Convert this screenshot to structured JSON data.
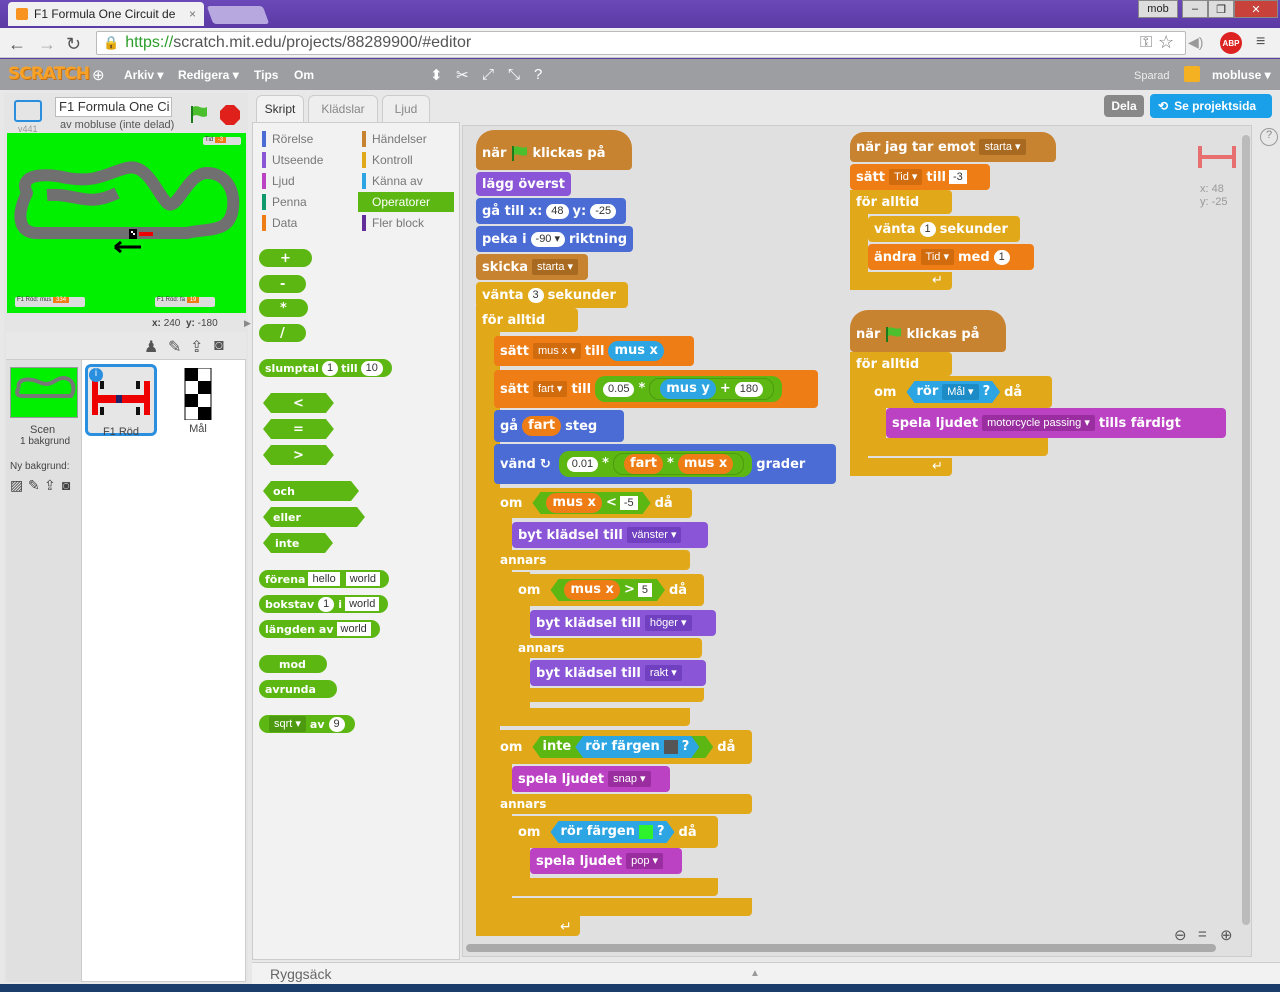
{
  "browser": {
    "tab_title": "F1 Formula One Circuit de",
    "url_https": "https://",
    "url_rest": "scratch.mit.edu/projects/88289900/#editor",
    "window_user": "mob",
    "abp": "ABP"
  },
  "menu": {
    "logo": "SCRATCH",
    "items": [
      "Arkiv",
      "Redigera",
      "Tips",
      "Om"
    ],
    "saved": "Sparad",
    "user": "mobluse",
    "share": "Dela",
    "see_project": "Se projektsida"
  },
  "stage": {
    "project_title": "F1 Formula One Ci",
    "version": "v441",
    "byline": "av mobluse (inte delad)",
    "x_label": "x:",
    "x_val": "240",
    "y_label": "y:",
    "y_val": "-180",
    "mon_tid": "Tid",
    "mon_tid_val": "-3",
    "mon1_label": "F1 Röd: mus",
    "mon1_val": "334",
    "mon2_label": "F1 Röd: fa",
    "mon2_val": "19"
  },
  "sprites": {
    "scene_label": "Scen",
    "scene_sub": "1 bakgrund",
    "new_bg": "Ny bakgrund:",
    "items": [
      {
        "name": "F1 Röd"
      },
      {
        "name": "Mål"
      }
    ]
  },
  "tabs": [
    "Skript",
    "Klädslar",
    "Ljud"
  ],
  "categories_left": [
    "Rörelse",
    "Utseende",
    "Ljud",
    "Penna",
    "Data"
  ],
  "categories_right": [
    "Händelser",
    "Kontroll",
    "Känna av",
    "Operatorer",
    "Fler block"
  ],
  "category_colors": {
    "Rörelse": "#4a6cd4",
    "Utseende": "#8a55d7",
    "Ljud": "#bb42c3",
    "Penna": "#0e9a6c",
    "Data": "#ee7d16",
    "Händelser": "#c88330",
    "Kontroll": "#e1a91a",
    "Känna av": "#2ca5e2",
    "Operatorer": "#5cb712",
    "Fler block": "#632d99"
  },
  "palette": {
    "plus": "+",
    "minus": "-",
    "times": "*",
    "div": "/",
    "random": "slumptal",
    "random_from": "1",
    "random_to_label": "till",
    "random_to": "10",
    "lt": "<",
    "eq": "=",
    "gt": ">",
    "and": "och",
    "or": "eller",
    "not": "inte",
    "join": "förena",
    "join_a": "hello",
    "join_b": "world",
    "letter": "bokstav",
    "letter_n": "1",
    "letter_of": "i",
    "letter_w": "world",
    "length": "längden",
    "length_of": "av",
    "length_w": "world",
    "mod": "mod",
    "round": "avrunda",
    "sqrt": "sqrt",
    "sqrt_of": "av",
    "sqrt_n": "9"
  },
  "script1": {
    "hat_when": "när",
    "hat_clicked": "klickas på",
    "front": "lägg överst",
    "goto": "gå till x:",
    "goto_x": "48",
    "goto_y_label": "y:",
    "goto_y": "-25",
    "point": "peka i",
    "point_val": "-90",
    "point_dir": "riktning",
    "broadcast": "skicka",
    "broadcast_msg": "starta",
    "wait": "vänta",
    "wait_n": "3",
    "wait_unit": "sekunder",
    "forever": "för alltid",
    "set": "sätt",
    "var_mousex": "mus x",
    "to": "till",
    "mousex": "mus x",
    "var_fart": "fart",
    "f005": "0.05",
    "mul": "*",
    "mousey": "mus y",
    "plus": "+",
    "n180": "180",
    "move": "gå",
    "fart": "fart",
    "steps": "steg",
    "turn": "vänd",
    "f001": "0.01",
    "degrees": "grader",
    "if": "om",
    "then": "då",
    "lt": "<",
    "n_neg5": "-5",
    "switch": "byt klädsel till",
    "left": "vänster",
    "else": "annars",
    "gt": ">",
    "n5": "5",
    "right": "höger",
    "straight": "rakt",
    "not": "inte",
    "touch_color": "rör färgen",
    "q": "?",
    "play": "spela ljudet",
    "snap": "snap",
    "pop": "pop"
  },
  "script2": {
    "hat": "när jag tar emot",
    "msg": "starta",
    "set": "sätt",
    "var": "Tid",
    "to": "till",
    "val": "-3",
    "forever": "för alltid",
    "wait": "vänta",
    "wait_n": "1",
    "wait_unit": "sekunder",
    "change": "ändra",
    "change_var": "Tid",
    "by": "med",
    "by_n": "1"
  },
  "script3": {
    "hat_when": "när",
    "hat_clicked": "klickas på",
    "forever": "för alltid",
    "if": "om",
    "touch": "rör",
    "touch_obj": "Mål",
    "q": "?",
    "then": "då",
    "play": "spela ljudet",
    "sound": "motorcycle passing",
    "until_done": "tills färdigt"
  },
  "sprite_info": {
    "x_label": "x:",
    "x": "48",
    "y_label": "y:",
    "y": "-25"
  },
  "backpack": "Ryggsäck",
  "colors": {
    "accent": "#5cb712",
    "menubar": "#9c9ea2",
    "share": "#1aa0e8"
  }
}
